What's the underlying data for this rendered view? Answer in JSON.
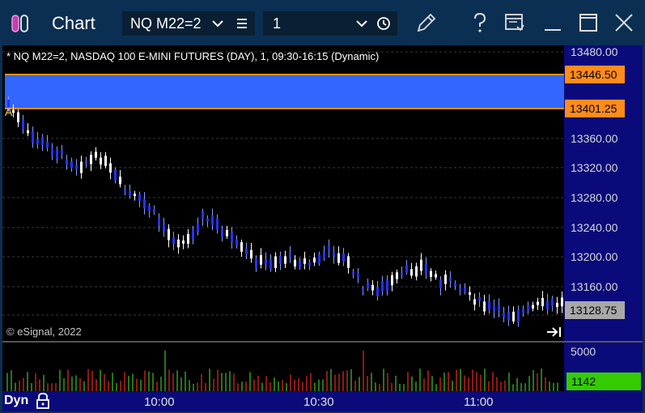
{
  "window": {
    "title": "Chart",
    "symbol": "NQ M22=2",
    "interval": "1"
  },
  "chart": {
    "header": "* NQ M22=2, NASDAQ 100 E-MINI FUTURES (DAY), 1, 09:30-16:15 (Dynamic)",
    "copyright": "© eSignal, 2022",
    "marker": "A",
    "price_labels": [
      "13480.00",
      "13360.00",
      "13320.00",
      "13280.00",
      "13240.00",
      "13200.00",
      "13160.00"
    ],
    "price_tags": {
      "high": "13446.50",
      "low": "13401.25",
      "last": "13128.75"
    },
    "volume_label": "5000",
    "volume_tag": "1142",
    "time_labels": [
      "10:00",
      "10:30",
      "11:00"
    ],
    "mode": "Dyn",
    "colors": {
      "up": "#ffffff",
      "down": "#2233ff",
      "zone": "#3366ff",
      "zone_border": "#ff8c1a",
      "vol_up": "#33aa22",
      "vol_down": "#cc2222",
      "last_tag": "#a8a8a8",
      "tag": "#ff8c1a"
    }
  },
  "icons": [
    "app-icon",
    "chevron-down-icon",
    "menu-icon",
    "clock-icon",
    "pencil-icon",
    "help-icon",
    "window-link-icon",
    "minimize-icon",
    "maximize-icon",
    "close-icon",
    "lock-icon",
    "scroll-end-icon"
  ]
}
